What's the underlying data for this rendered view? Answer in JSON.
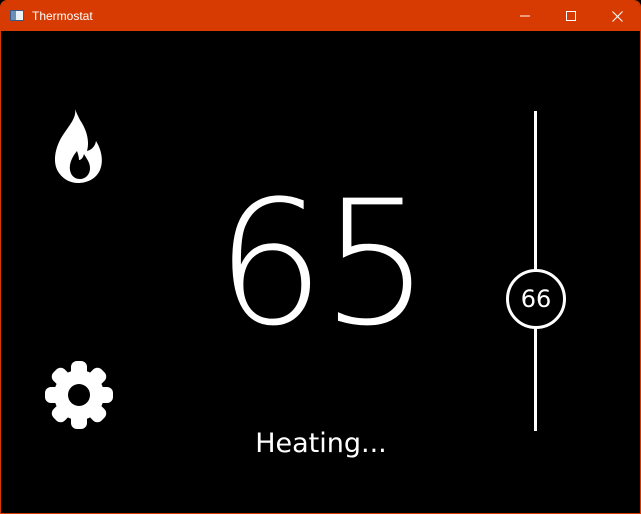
{
  "window": {
    "title": "Thermostat",
    "accent_color": "#d83b01",
    "controls": [
      "minimize-icon",
      "maximize-icon",
      "close-icon"
    ]
  },
  "thermostat": {
    "mode_icon": "flame-icon",
    "settings_icon": "gear-icon",
    "current_temperature": "65",
    "status": "Heating...",
    "setpoint": "66"
  }
}
